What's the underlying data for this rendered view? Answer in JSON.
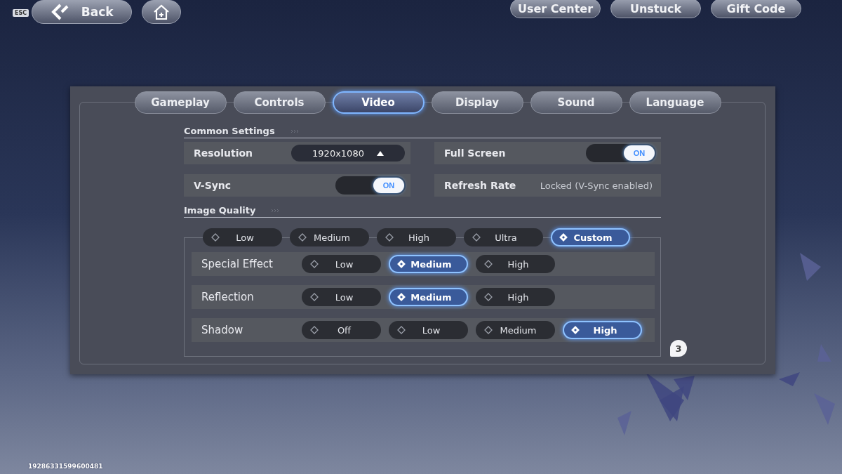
{
  "top_bar": {
    "esc_key": "ESC",
    "back": "Back",
    "buttons": [
      "User Center",
      "Unstuck",
      "Gift Code"
    ]
  },
  "tabs": [
    {
      "label": "Gameplay",
      "selected": false
    },
    {
      "label": "Controls",
      "selected": false
    },
    {
      "label": "Video",
      "selected": true
    },
    {
      "label": "Display",
      "selected": false
    },
    {
      "label": "Sound",
      "selected": false
    },
    {
      "label": "Language",
      "selected": false
    }
  ],
  "common_settings": {
    "title": "Common Settings",
    "items": [
      {
        "kind": "dropdown",
        "label": "Resolution",
        "value": "1920x1080"
      },
      {
        "kind": "toggle",
        "label": "Full Screen",
        "on": true,
        "text": "ON"
      },
      {
        "kind": "toggle",
        "label": "V-Sync",
        "on": true,
        "text": "ON"
      },
      {
        "kind": "info",
        "label": "Refresh Rate",
        "value": "Locked (V-Sync enabled)"
      }
    ]
  },
  "image_quality": {
    "title": "Image Quality",
    "presets": [
      {
        "label": "Low",
        "selected": false
      },
      {
        "label": "Medium",
        "selected": false
      },
      {
        "label": "High",
        "selected": false
      },
      {
        "label": "Ultra",
        "selected": false
      },
      {
        "label": "Custom",
        "selected": true
      }
    ],
    "settings": [
      {
        "label": "Special Effect",
        "options": [
          {
            "label": "Low",
            "selected": false
          },
          {
            "label": "Medium",
            "selected": true
          },
          {
            "label": "High",
            "selected": false
          }
        ]
      },
      {
        "label": "Reflection",
        "options": [
          {
            "label": "Low",
            "selected": false
          },
          {
            "label": "Medium",
            "selected": true
          },
          {
            "label": "High",
            "selected": false
          }
        ]
      },
      {
        "label": "Shadow",
        "options": [
          {
            "label": "Off",
            "selected": false
          },
          {
            "label": "Low",
            "selected": false
          },
          {
            "label": "Medium",
            "selected": false
          },
          {
            "label": "High",
            "selected": true
          }
        ]
      }
    ]
  },
  "badge": "3",
  "uid": "19286331599600481"
}
